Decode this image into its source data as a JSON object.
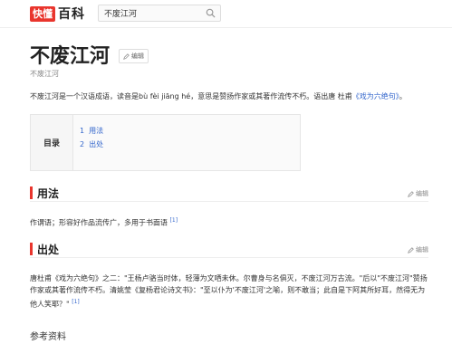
{
  "header": {
    "logo_box": "快懂",
    "logo_text": "百科",
    "search_value": "不废江河"
  },
  "title": "不废江河",
  "edit_label": "编辑",
  "subtitle": "不废江河",
  "intro": {
    "text_before": "不废江河是一个汉语成语，读音是bù fèi jiāng hé，意思是赞扬作家或其著作流传不朽。语出唐 杜甫",
    "book": "《戏为六绝句》",
    "text_after": "。"
  },
  "toc": {
    "label": "目录",
    "items": [
      {
        "num": "1",
        "label": "用法"
      },
      {
        "num": "2",
        "label": "出处"
      }
    ]
  },
  "sections": [
    {
      "heading": "用法",
      "edit_label": "编辑",
      "text": "作谓语；形容好作品流传广，多用于书面语",
      "ref": "[1]"
    },
    {
      "heading": "出处",
      "edit_label": "编辑",
      "text": "唐杜甫《戏为六绝句》之二：\"王杨卢骆当时体，轻薄为文哂未休。尔曹身与名俱灭，不废江河万古流。\"后以\"不废江河\"赞扬作家或其著作流传不朽。清姚莹《复杨君论诗文书》：\"至以仆为'不废江河'之喻，则不敢当；此自是下阿其所好耳，然得无为他人笑耶？\"",
      "ref": "[1]"
    }
  ],
  "references_title": "参考资料"
}
